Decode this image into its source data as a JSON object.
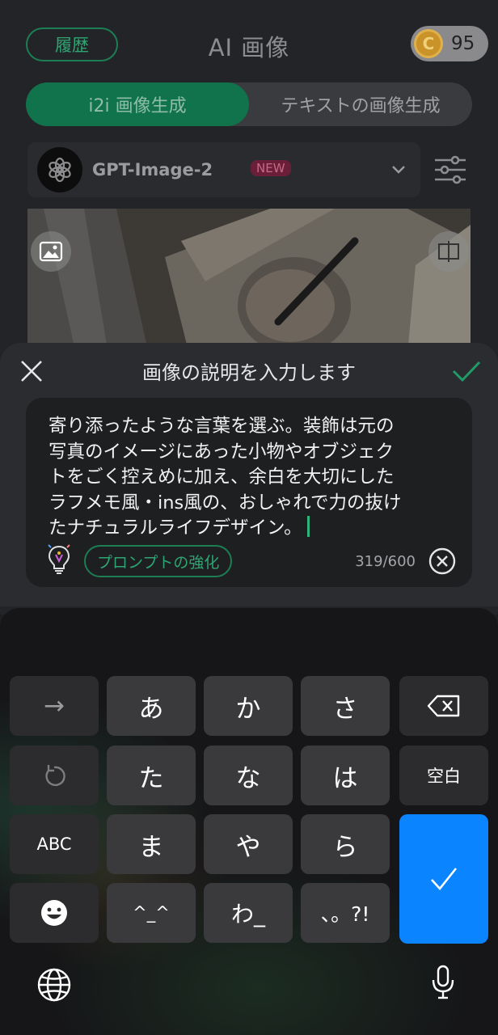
{
  "header": {
    "history_label": "履歴",
    "title": "AI 画像",
    "coin_symbol": "C",
    "coins": "95"
  },
  "mode_tabs": [
    {
      "label": "i2i 画像生成",
      "active": true
    },
    {
      "label": "テキストの画像生成",
      "active": false
    }
  ],
  "model": {
    "name": "GPT-Image-2",
    "badge": "NEW",
    "logo_icon": "openai-logo-icon"
  },
  "prompt_sheet": {
    "title": "画像の説明を入力します",
    "text": "寄り添ったような言葉を選ぶ。装飾は元の\n写真のイメージにあった小物やオブジェク\nトをごく控えめに加え、余白を大切にした\nラフメモ風・ins風の、おしゃれで力の抜け\nたナチュラルライフデザイン。",
    "enhance_label": "プロンプトの強化",
    "char_count": "319/600"
  },
  "keyboard": {
    "rows": [
      [
        "→",
        "あ",
        "か",
        "さ",
        "delete-icon"
      ],
      [
        "undo-icon",
        "た",
        "な",
        "は",
        "空白"
      ],
      [
        "ABC",
        "ま",
        "や",
        "ら",
        "confirm-icon"
      ],
      [
        "emoji-icon",
        "^_^",
        "わ_",
        "、。?!"
      ]
    ],
    "arrow": "→",
    "a": "あ",
    "ka": "か",
    "sa": "さ",
    "ta": "た",
    "na": "な",
    "ha": "は",
    "space": "空白",
    "abc": "ABC",
    "ma": "ま",
    "ya": "や",
    "ra": "ら",
    "kaomoji": "^_^",
    "wa": "わ_",
    "punct": "、。?!"
  },
  "colors": {
    "accent_green": "#11734b",
    "confirm_blue": "#0a84ff",
    "new_badge": "#6b1e37"
  }
}
